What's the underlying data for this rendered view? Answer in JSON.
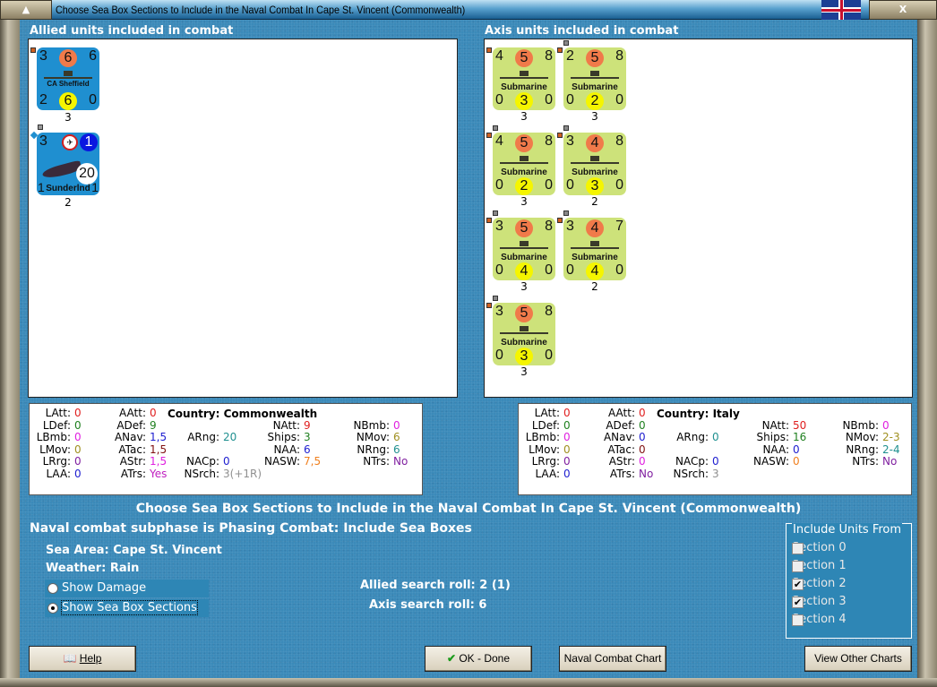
{
  "window": {
    "title": "Choose Sea Box Sections to Include in the Naval Combat In Cape St. Vincent (Commonwealth)",
    "minimize_label": "▲",
    "close_label": "X",
    "flag": "union-jack"
  },
  "allied": {
    "header": "Allied units included in combat",
    "units": [
      {
        "type": "ship",
        "name": "CA Sheffield",
        "tl": "3",
        "tm": "6",
        "tr": "6",
        "bl": "2",
        "bm": "6",
        "br": "0",
        "below": "3",
        "color": "#1f8fd0"
      },
      {
        "type": "air",
        "name": "Sunderlnd",
        "tl": "3",
        "tr": "1",
        "mid": "20",
        "bl": "1",
        "br": "1",
        "below": "2",
        "color": "#1f8fd0"
      }
    ]
  },
  "axis": {
    "header": "Axis units included in combat",
    "units": [
      {
        "name": "Submarine",
        "tl": "4",
        "tm": "5",
        "tr": "8",
        "bl": "0",
        "bm": "3",
        "br": "0",
        "below": "3"
      },
      {
        "name": "Submarine",
        "tl": "2",
        "tm": "5",
        "tr": "8",
        "bl": "0",
        "bm": "2",
        "br": "0",
        "below": "3"
      },
      {
        "name": "Submarine",
        "tl": "4",
        "tm": "5",
        "tr": "8",
        "bl": "0",
        "bm": "2",
        "br": "0",
        "below": "3"
      },
      {
        "name": "Submarine",
        "tl": "3",
        "tm": "4",
        "tr": "8",
        "bl": "0",
        "bm": "3",
        "br": "0",
        "below": "2"
      },
      {
        "name": "Submarine",
        "tl": "3",
        "tm": "5",
        "tr": "8",
        "bl": "0",
        "bm": "4",
        "br": "0",
        "below": "3"
      },
      {
        "name": "Submarine",
        "tl": "3",
        "tm": "4",
        "tr": "7",
        "bl": "0",
        "bm": "4",
        "br": "0",
        "below": "2"
      },
      {
        "name": "Submarine",
        "tl": "3",
        "tm": "5",
        "tr": "8",
        "bl": "0",
        "bm": "3",
        "br": "0",
        "below": "3"
      }
    ]
  },
  "allied_stats": {
    "country": "Country: Commonwealth",
    "stats": [
      [
        "LAtt:",
        "0",
        "#e02020",
        0,
        0
      ],
      [
        "AAtt:",
        "0",
        "#e02020",
        1,
        0
      ],
      [
        "LDef:",
        "0",
        "#208020",
        0,
        1
      ],
      [
        "ADef:",
        "9",
        "#208020",
        1,
        1
      ],
      [
        "NAtt:",
        "9",
        "#e02020",
        3,
        1
      ],
      [
        "NBmb:",
        "0",
        "#e020e0",
        4,
        1
      ],
      [
        "LBmb:",
        "0",
        "#e020e0",
        0,
        2
      ],
      [
        "ANav:",
        "1,5",
        "#2020d0",
        1,
        2
      ],
      [
        "ARng:",
        "20",
        "#209090",
        2,
        2
      ],
      [
        "Ships:",
        "3",
        "#208020",
        3,
        2
      ],
      [
        "NMov:",
        "6",
        "#a09020",
        4,
        2
      ],
      [
        "LMov:",
        "0",
        "#a09020",
        0,
        3
      ],
      [
        "ATac:",
        "1,5",
        "#801010",
        1,
        3
      ],
      [
        "NAA:",
        "6",
        "#2020d0",
        3,
        3
      ],
      [
        "NRng:",
        "6",
        "#209090",
        4,
        3
      ],
      [
        "LRrg:",
        "0",
        "#8020a0",
        0,
        4
      ],
      [
        "AStr:",
        "1,5",
        "#e020e0",
        1,
        4
      ],
      [
        "NACp:",
        "0",
        "#2020d0",
        2,
        4
      ],
      [
        "NASW:",
        "7,5",
        "#f08020",
        3,
        4
      ],
      [
        "NTrs:",
        "No",
        "#8020a0",
        4,
        4
      ],
      [
        "LAA:",
        "0",
        "#2020d0",
        0,
        5
      ],
      [
        "ATrs:",
        "Yes",
        "#c020c0",
        1,
        5
      ],
      [
        "NSrch:",
        "3(+1R)",
        "#909090",
        2,
        5
      ]
    ]
  },
  "axis_stats": {
    "country": "Country: Italy",
    "stats": [
      [
        "LAtt:",
        "0",
        "#e02020",
        0,
        0
      ],
      [
        "AAtt:",
        "0",
        "#e02020",
        1,
        0
      ],
      [
        "LDef:",
        "0",
        "#208020",
        0,
        1
      ],
      [
        "ADef:",
        "0",
        "#208020",
        1,
        1
      ],
      [
        "NAtt:",
        "50",
        "#e02020",
        3,
        1
      ],
      [
        "NBmb:",
        "0",
        "#e020e0",
        4,
        1
      ],
      [
        "LBmb:",
        "0",
        "#e020e0",
        0,
        2
      ],
      [
        "ANav:",
        "0",
        "#2020d0",
        1,
        2
      ],
      [
        "ARng:",
        "0",
        "#209090",
        2,
        2
      ],
      [
        "Ships:",
        "16",
        "#208020",
        3,
        2
      ],
      [
        "NMov:",
        "2-3",
        "#a09020",
        4,
        2
      ],
      [
        "LMov:",
        "0",
        "#a09020",
        0,
        3
      ],
      [
        "ATac:",
        "0",
        "#801010",
        1,
        3
      ],
      [
        "NAA:",
        "0",
        "#2020d0",
        3,
        3
      ],
      [
        "NRng:",
        "2-4",
        "#209090",
        4,
        3
      ],
      [
        "LRrg:",
        "0",
        "#8020a0",
        0,
        4
      ],
      [
        "AStr:",
        "0",
        "#e020e0",
        1,
        4
      ],
      [
        "NACp:",
        "0",
        "#2020d0",
        2,
        4
      ],
      [
        "NASW:",
        "0",
        "#f08020",
        3,
        4
      ],
      [
        "NTrs:",
        "No",
        "#8020a0",
        4,
        4
      ],
      [
        "LAA:",
        "0",
        "#2020d0",
        0,
        5
      ],
      [
        "ATrs:",
        "No",
        "#8020a0",
        1,
        5
      ],
      [
        "NSrch:",
        "3",
        "#909090",
        2,
        5
      ]
    ]
  },
  "info": {
    "heading": "Choose Sea Box Sections to Include in the Naval Combat In Cape St. Vincent (Commonwealth)",
    "subphase": "Naval combat subphase is Phasing Combat: Include Sea Boxes",
    "sea_area": "Sea Area:  Cape St. Vincent",
    "weather": "Weather:  Rain",
    "allied_roll": "Allied search roll: 2 (1)",
    "axis_roll": "Axis search roll: 6"
  },
  "view_options": [
    {
      "label": "Show Damage",
      "selected": false
    },
    {
      "label": "Show Sea Box Sections",
      "selected": true
    }
  ],
  "include_units": {
    "title": "Include Units From",
    "sections": [
      {
        "label": "Section 0",
        "checked": false
      },
      {
        "label": "Section 1",
        "checked": false
      },
      {
        "label": "Section 2",
        "checked": true
      },
      {
        "label": "Section 3",
        "checked": true
      },
      {
        "label": "Section 4",
        "checked": false
      }
    ]
  },
  "buttons": {
    "help": "Help",
    "ok": "OK - Done",
    "naval_chart": "Naval Combat Chart",
    "other_charts": "View Other Charts"
  }
}
